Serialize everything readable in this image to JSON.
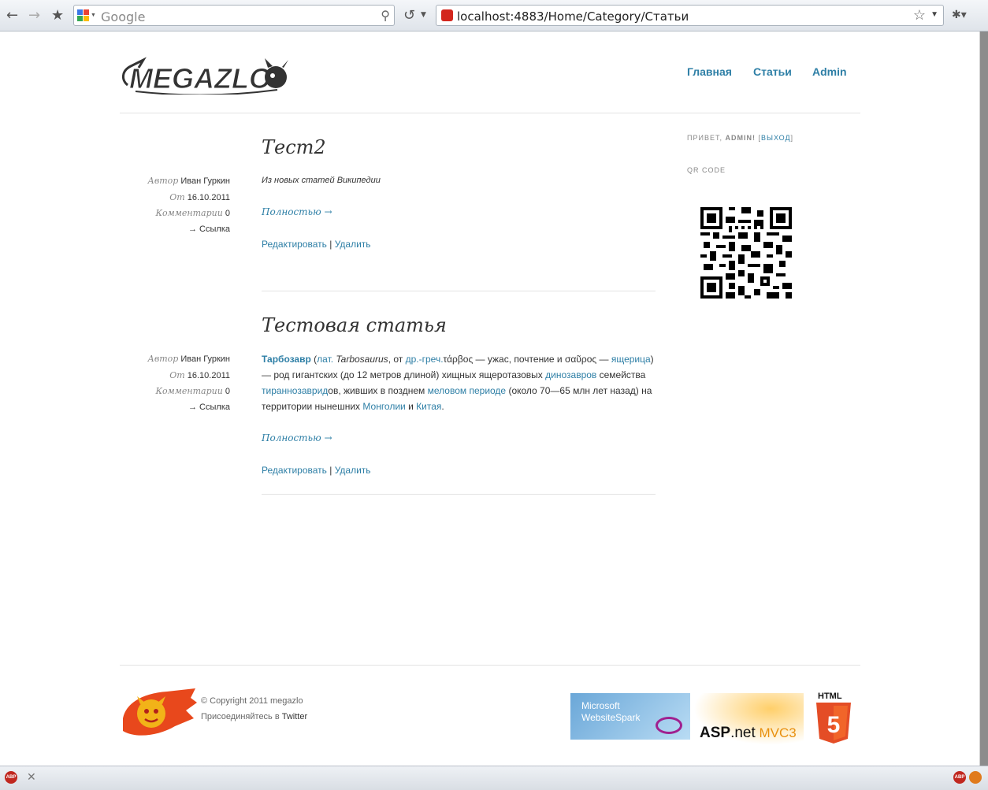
{
  "browser": {
    "search_placeholder": "Google",
    "url": "localhost:4883/Home/Category/Статьи"
  },
  "site": {
    "logo_text": "MEGAZLO",
    "nav": [
      "Главная",
      "Статьи",
      "Admin"
    ]
  },
  "posts": [
    {
      "title": "Тест2",
      "author_label": "Автор",
      "author": "Иван Гуркин",
      "date_label": "От",
      "date": "16.10.2011",
      "comments_label": "Комментарии",
      "comments": "0",
      "link_label": "→ Ссылка",
      "excerpt": "Из новых статей Википедии",
      "more": "Полностью →",
      "edit": "Редактировать",
      "sep": "|",
      "delete": "Удалить"
    },
    {
      "title": "Тестовая статья",
      "author_label": "Автор",
      "author": "Иван Гуркин",
      "date_label": "От",
      "date": "16.10.2011",
      "comments_label": "Комментарии",
      "comments": "0",
      "link_label": "→ Ссылка",
      "body": {
        "t1": "Тарбозавр",
        "t2": " (",
        "t3": "лат.",
        "t4": " ",
        "t5": "Tarbosaurus",
        "t6": ", от ",
        "t7": "др.-греч.",
        "t8": "τάρβος — ужас, почтение и σαῦρος — ",
        "t9": "ящерица",
        "t10": ") — род гигантских (до 12 метров длиной) хищных ящеротазовых ",
        "t11": "динозавров",
        "t12": " семейства ",
        "t13": "тираннозаврид",
        "t14": "ов, живших в позднем ",
        "t15": "меловом периоде",
        "t16": " (около 70—65 млн лет назад) на территории нынешних ",
        "t17": "Монголии",
        "t18": " и ",
        "t19": "Китая",
        "t20": "."
      },
      "more": "Полностью →",
      "edit": "Редактировать",
      "sep": "|",
      "delete": "Удалить"
    }
  ],
  "sidebar": {
    "greeting_prefix": "ПРИВЕТ, ",
    "greeting_user": "ADMIN!",
    "logout_open": " [",
    "logout": "ВЫХОД",
    "logout_close": "]",
    "qr_label": "QR CODE"
  },
  "footer": {
    "copyright": "© Copyright 2011 megazlo",
    "join_prefix": "Присоединяйтесь в ",
    "twitter": "Twitter",
    "badge1_line1": "Microsoft",
    "badge1_line2": "WebsiteSpark",
    "badge2_a": "ASP",
    "badge2_b": ".net",
    "badge2_c": " MVC3",
    "badge3": "HTML"
  },
  "colors": {
    "link": "#2e7fa6",
    "text": "#333333"
  }
}
